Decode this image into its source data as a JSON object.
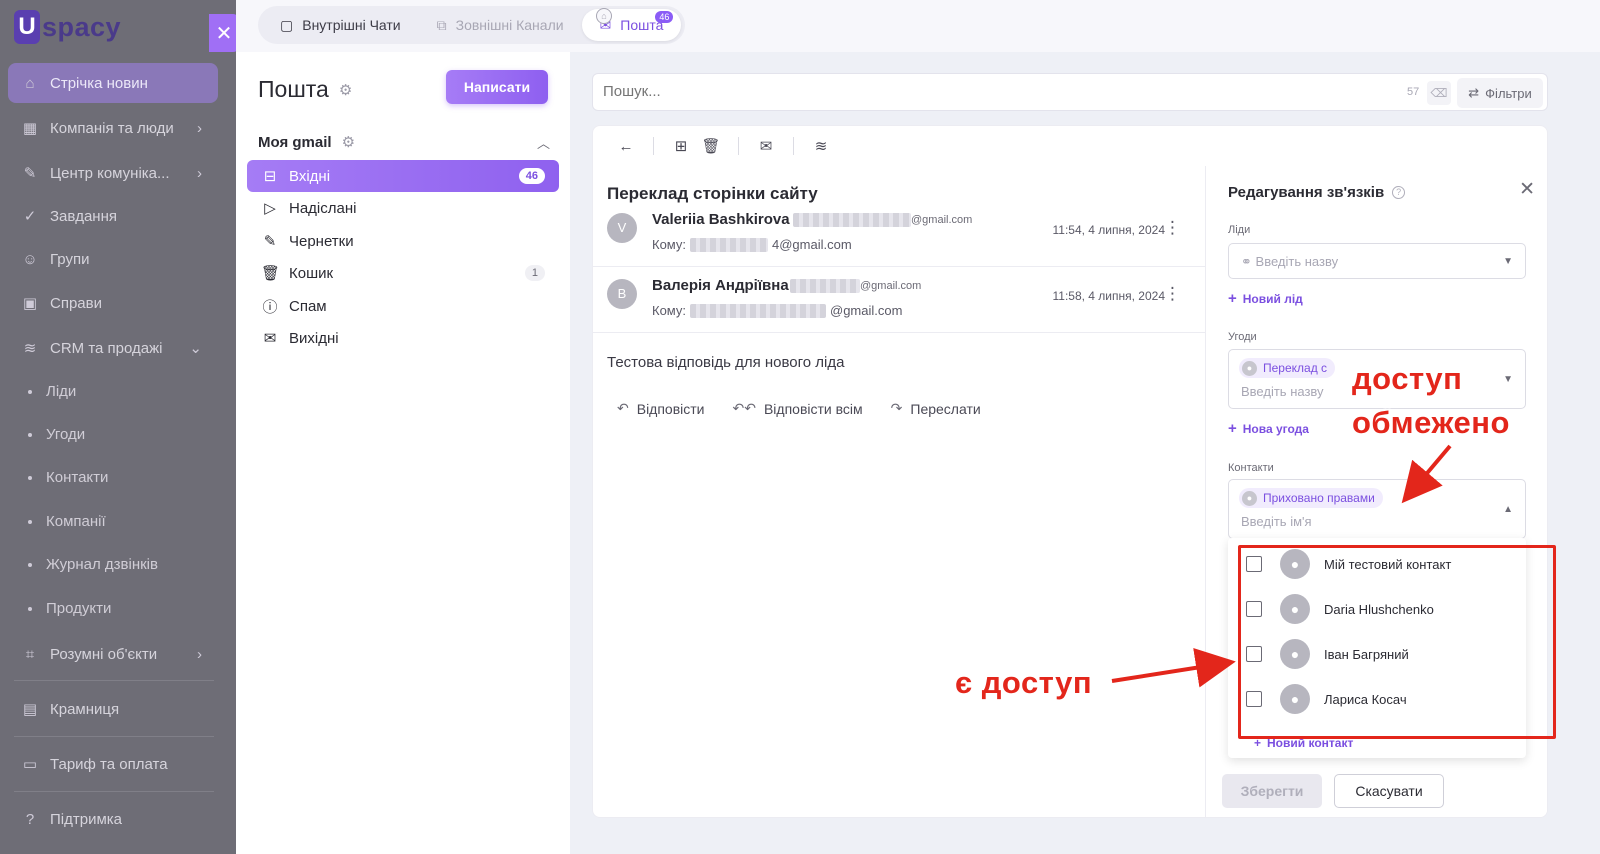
{
  "sidebar": {
    "logo": "spacy",
    "logo_mark": "U",
    "close": "✕",
    "items": [
      {
        "label": "Стрічка новин",
        "icon": "home-icon"
      },
      {
        "label": "Компанія та люди",
        "icon": "building-icon"
      },
      {
        "label": "Центр комуніка...",
        "icon": "compose-icon"
      },
      {
        "label": "Завдання",
        "icon": "check-circle-icon"
      },
      {
        "label": "Групи",
        "icon": "users-icon"
      },
      {
        "label": "Справи",
        "icon": "calendar-icon"
      },
      {
        "label": "CRM та продажі",
        "icon": "database-icon"
      },
      {
        "label": "Розумні об'єкти",
        "icon": "smart-object-icon"
      },
      {
        "label": "Крамниця",
        "icon": "store-icon"
      },
      {
        "label": "Тариф та оплата",
        "icon": "wallet-icon"
      },
      {
        "label": "Підтримка",
        "icon": "help-chat-icon"
      }
    ],
    "crm_sub": [
      "Ліди",
      "Угоди",
      "Контакти",
      "Компанії",
      "Журнал дзвінків",
      "Продукти"
    ]
  },
  "tabs": [
    {
      "label": "Внутрішні Чати",
      "icon": "chat-icon"
    },
    {
      "label": "Зовнішні Канали",
      "icon": "channels-icon"
    },
    {
      "label": "Пошта",
      "icon": "mail-icon",
      "badge": "46"
    }
  ],
  "mail": {
    "title": "Пошта",
    "compose": "Написати",
    "account": "Моя gmail",
    "folders": [
      {
        "label": "Вхідні",
        "count": "46",
        "icon": "inbox-icon"
      },
      {
        "label": "Надіслані",
        "count": "",
        "icon": "send-icon"
      },
      {
        "label": "Чернетки",
        "count": "",
        "icon": "draft-icon"
      },
      {
        "label": "Кошик",
        "count": "1",
        "icon": "trash-icon"
      },
      {
        "label": "Спам",
        "count": "",
        "icon": "spam-icon"
      },
      {
        "label": "Вихідні",
        "count": "",
        "icon": "outbox-icon"
      }
    ]
  },
  "search": {
    "placeholder": "Пошук...",
    "count": "57",
    "filters": "Фільтри"
  },
  "thread": {
    "subject": "Переклад сторінки сайту",
    "messages": [
      {
        "avatar": "V",
        "sender": "Valeriia Bashkirova",
        "sender_domain": "@gmail.com",
        "to_label": "Кому:",
        "to_domain": "4@gmail.com",
        "time": "11:54, 4 липня, 2024"
      },
      {
        "avatar": "В",
        "sender": "Валерія Андріївна",
        "sender_domain": "@gmail.com",
        "to_label": "Кому:",
        "to_domain": "@gmail.com",
        "time": "11:58, 4 липня, 2024"
      }
    ],
    "body": "Тестова відповідь для нового ліда",
    "actions": [
      "Відповісти",
      "Відповісти всім",
      "Переслати"
    ]
  },
  "drawer": {
    "title": "Редагування зв'язків",
    "leads_label": "Ліди",
    "leads_placeholder": "Введіть назву",
    "new_lead": "Новий лід",
    "deals_label": "Угоди",
    "deal_chip": "Переклад с",
    "deals_placeholder": "Введіть назву",
    "new_deal": "Нова угода",
    "contacts_label": "Контакти",
    "contact_chip": "Приховано правами",
    "contacts_placeholder": "Введіть ім'я",
    "contacts_options": [
      "Мій тестовий контакт",
      "Daria Hlushchenko",
      "Іван Багряний",
      "Лариса Косач"
    ],
    "new_contact": "Новий контакт",
    "save": "Зберегти",
    "cancel": "Скасувати"
  },
  "annotations": {
    "restricted_line1": "доступ",
    "restricted_line2": "обмежено",
    "has_access": "є доступ",
    "color": "#e3261b"
  }
}
